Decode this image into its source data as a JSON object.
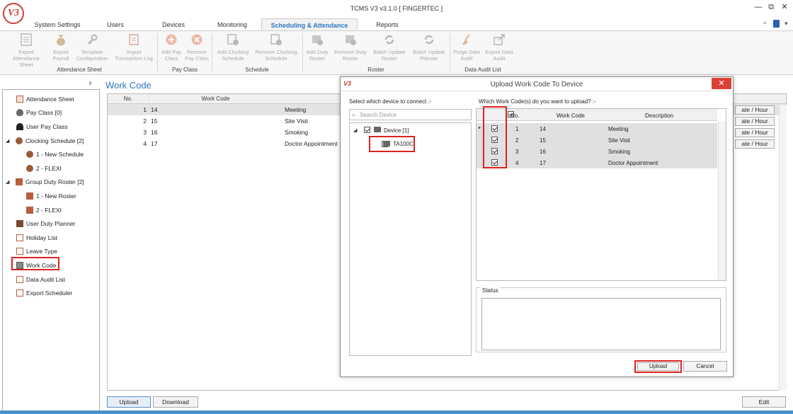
{
  "app": {
    "title": "TCMS V3 v3.1.0 [ FINGERTEC ]",
    "logo": "V3"
  },
  "window_controls": {
    "minimize": "—",
    "restore": "⧉",
    "close": "✕"
  },
  "tabs": [
    "System Settings",
    "Users",
    "Devices",
    "Monitoring",
    "Scheduling & Attendance",
    "Reports"
  ],
  "ribbon": {
    "buttons": [
      "Export Attendance Sheet",
      "Export Payroll",
      "Template Configuration",
      "Import Transaction Log",
      "Add Pay Class",
      "Remove Pay Class",
      "Add Clocking Schedule",
      "Remove Clocking Schedule",
      "Add Duty Roster",
      "Remove Duty Roster",
      "Batch Update Roster",
      "Batch Update Planner",
      "Purge Data Audit",
      "Export Data Audit"
    ],
    "groups": [
      "Attendance Sheet",
      "Pay Class",
      "Schedule",
      "Roster",
      "Data Audit List"
    ]
  },
  "tree": {
    "pin": "ᵖ",
    "items": [
      {
        "label": "Attendance Sheet",
        "icon": "sheet-icon",
        "level": 0
      },
      {
        "label": "Pay Class [0]",
        "icon": "money-bag-icon",
        "level": 0
      },
      {
        "label": "User Pay Class",
        "icon": "user-icon",
        "level": 0
      },
      {
        "label": "Clocking Schedule [2]",
        "icon": "clock-icon",
        "level": 0,
        "expanded": true
      },
      {
        "label": "1 - New Schedule",
        "icon": "clock-icon",
        "level": 1
      },
      {
        "label": "2 - FLEXI",
        "icon": "clock-icon",
        "level": 1
      },
      {
        "label": "Group Duty Roster [2]",
        "icon": "calendar-icon",
        "level": 0,
        "expanded": true
      },
      {
        "label": "1 - New Roster",
        "icon": "calendar-icon",
        "level": 1
      },
      {
        "label": "2 - FLEXI",
        "icon": "calendar-icon",
        "level": 1
      },
      {
        "label": "User Duty Planner",
        "icon": "briefcase-icon",
        "level": 0
      },
      {
        "label": "Holiday List",
        "icon": "list-icon",
        "level": 0
      },
      {
        "label": "Leave Type",
        "icon": "list-icon",
        "level": 0
      },
      {
        "label": "Work Code",
        "icon": "card-icon",
        "level": 0,
        "highlighted": true
      },
      {
        "label": "Data Audit List",
        "icon": "list-icon",
        "level": 0
      },
      {
        "label": "Export Scheduler",
        "icon": "list-icon",
        "level": 0
      }
    ]
  },
  "work_code": {
    "title": "Work Code",
    "columns": [
      "No.",
      "Work Code"
    ],
    "rows": [
      {
        "no": "1",
        "code": "14",
        "desc": "Meeting"
      },
      {
        "no": "2",
        "code": "15",
        "desc": "Site Visit"
      },
      {
        "no": "3",
        "code": "16",
        "desc": "Smoking"
      },
      {
        "no": "4",
        "code": "17",
        "desc": "Doctor Appointment"
      }
    ],
    "rate_label": "ate / Hour",
    "upload": "Upload",
    "download": "Download",
    "edit": "Edit"
  },
  "dialog": {
    "title": "Upload Work Code To Device",
    "logo": "V3",
    "close": "✕",
    "device_prompt": "Select which device to connect :-",
    "search_placeholder": "Search Device",
    "device_root": "Device [1]",
    "device_child": "TA100C",
    "workcode_prompt": "Which Work Code(s) do you want to upload? :-",
    "columns": [
      "No.",
      "Work Code",
      "Description"
    ],
    "rows": [
      {
        "no": "1",
        "code": "14",
        "desc": "Meeting"
      },
      {
        "no": "2",
        "code": "15",
        "desc": "Site Visit"
      },
      {
        "no": "3",
        "code": "16",
        "desc": "Smoking"
      },
      {
        "no": "4",
        "code": "17",
        "desc": "Doctor Appointment"
      }
    ],
    "status_label": "Status",
    "upload": "Upload",
    "cancel": "Cancel"
  }
}
